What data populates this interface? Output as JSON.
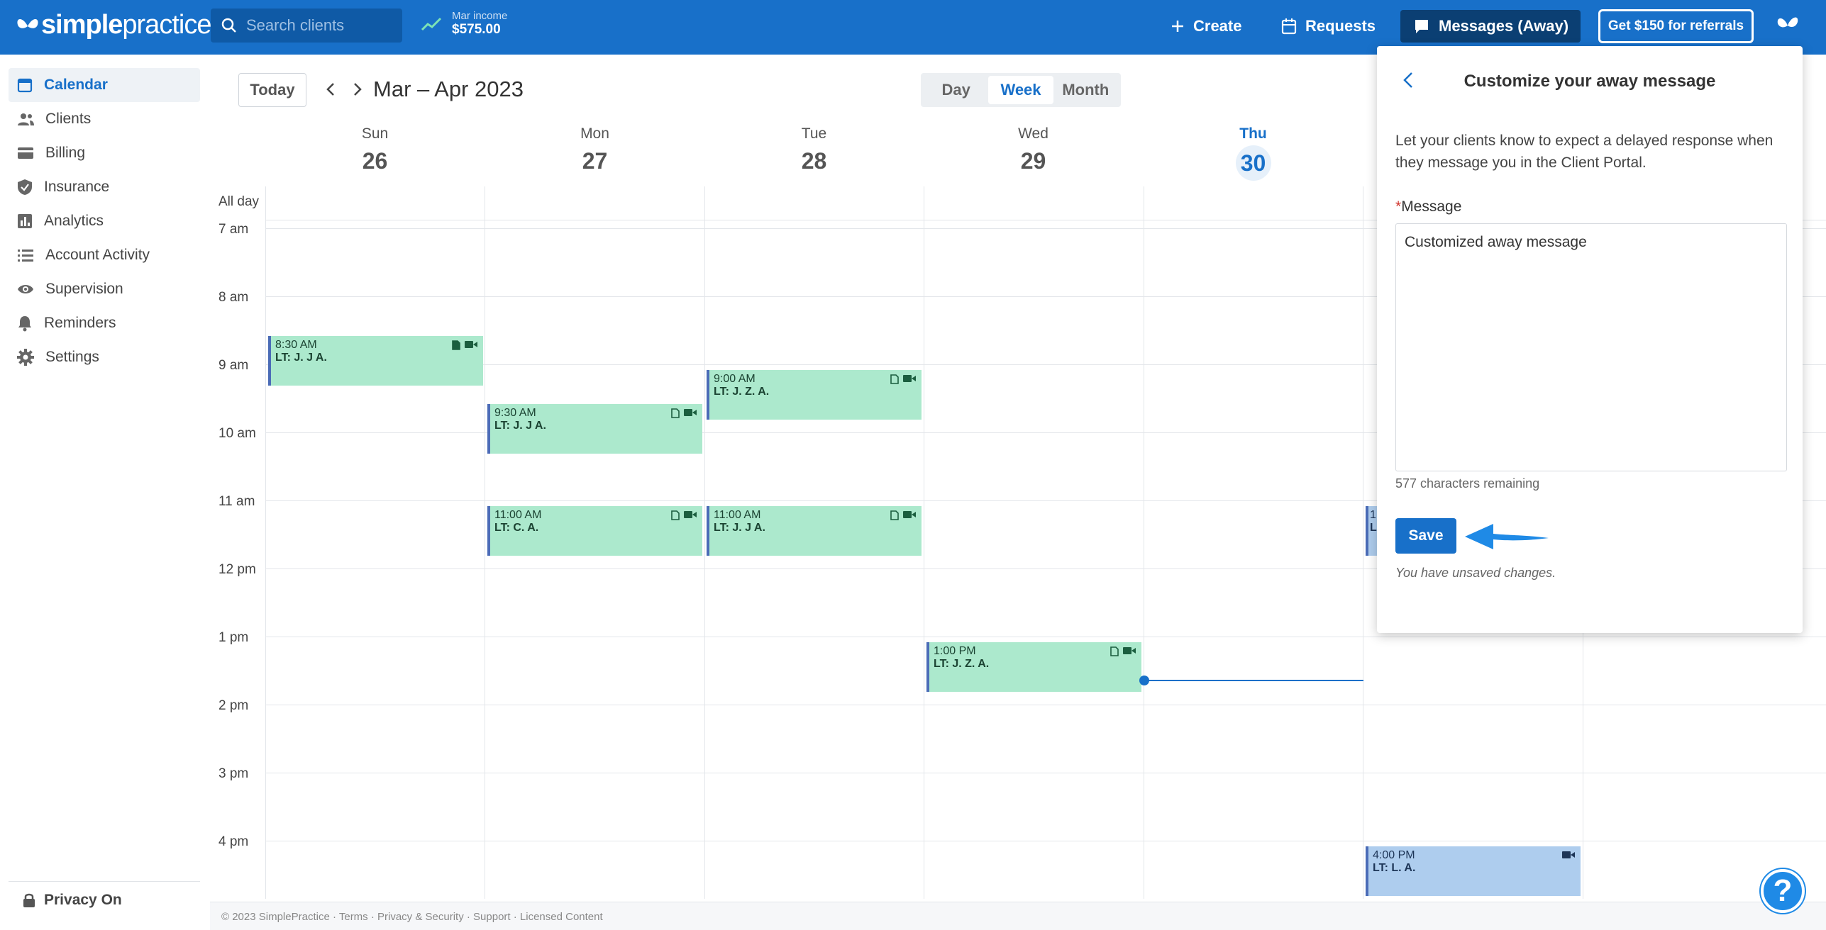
{
  "topbar": {
    "logo_bold": "simple",
    "logo_light": "practice",
    "search_placeholder": "Search clients",
    "income_label": "Mar income",
    "income_value": "$575.00",
    "create_label": "Create",
    "requests_label": "Requests",
    "messages_label": "Messages (Away)",
    "referral_label": "Get $150 for referrals"
  },
  "sidebar": {
    "items": [
      {
        "label": "Calendar",
        "icon": "calendar-icon"
      },
      {
        "label": "Clients",
        "icon": "people-icon"
      },
      {
        "label": "Billing",
        "icon": "credit-card-icon"
      },
      {
        "label": "Insurance",
        "icon": "shield-icon"
      },
      {
        "label": "Analytics",
        "icon": "bar-chart-icon"
      },
      {
        "label": "Account Activity",
        "icon": "list-icon"
      },
      {
        "label": "Supervision",
        "icon": "eye-icon"
      },
      {
        "label": "Reminders",
        "icon": "bell-icon"
      },
      {
        "label": "Settings",
        "icon": "gear-icon"
      }
    ],
    "privacy_label": "Privacy On"
  },
  "calendar": {
    "today_label": "Today",
    "range_title": "Mar – Apr 2023",
    "views": [
      "Day",
      "Week",
      "Month"
    ],
    "active_view": "Week",
    "days": [
      {
        "name": "Sun",
        "num": "26"
      },
      {
        "name": "Mon",
        "num": "27"
      },
      {
        "name": "Tue",
        "num": "28"
      },
      {
        "name": "Wed",
        "num": "29"
      },
      {
        "name": "Thu",
        "num": "30"
      }
    ],
    "all_day_label": "All day",
    "hours": [
      "7 am",
      "8 am",
      "9 am",
      "10 am",
      "11 am",
      "12 pm",
      "1 pm",
      "2 pm",
      "3 pm",
      "4 pm"
    ],
    "events": [
      {
        "time": "8:30 AM",
        "client": "LT: J. J A."
      },
      {
        "time": "9:30 AM",
        "client": "LT: J. J A."
      },
      {
        "time": "9:00 AM",
        "client": "LT: J. Z. A."
      },
      {
        "time": "11:00 AM",
        "client": "LT: C. A."
      },
      {
        "time": "11:00 AM",
        "client": "LT: J. J A."
      },
      {
        "time": "1:00 PM",
        "client": "LT: J. Z. A."
      },
      {
        "time": "4:00 PM",
        "client": "LT: L. A."
      },
      {
        "time": "1",
        "client": "L"
      }
    ]
  },
  "footer": {
    "text": "© 2023 SimplePractice · Terms · Privacy & Security · Support · Licensed Content"
  },
  "panel": {
    "title": "Customize your away message",
    "description": "Let your clients know to expect a delayed response when they message you in the Client Portal.",
    "message_label": "Message",
    "required_mark": "*",
    "message_value": "Customized away message",
    "chars_remaining": "577 characters remaining",
    "save_label": "Save",
    "unsaved_note": "You have unsaved changes."
  },
  "help": {
    "label": "?"
  },
  "colors": {
    "brand": "#1870c9",
    "event_green": "#ace9cd",
    "event_blue": "#aecdee"
  }
}
